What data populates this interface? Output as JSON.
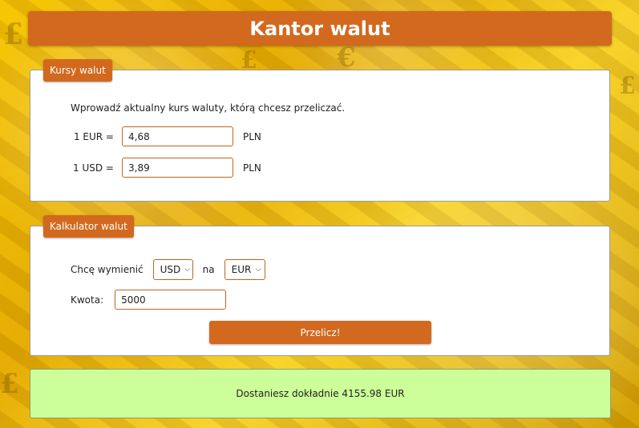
{
  "header": {
    "title": "Kantor walut"
  },
  "rates_panel": {
    "tab_label": "Kursy walut",
    "intro": "Wprowadź aktualny kurs waluty, którą chcesz przeliczać.",
    "eur": {
      "label": "1 EUR =",
      "value": "4,68",
      "unit": "PLN"
    },
    "usd": {
      "label": "1 USD =",
      "value": "3,89",
      "unit": "PLN"
    }
  },
  "calc_panel": {
    "tab_label": "Kalkulator walut",
    "exchange_label": "Chcę wymienić",
    "from_currency": "USD",
    "to_label": "na",
    "to_currency": "EUR",
    "amount_label": "Kwota:",
    "amount_value": "5000",
    "convert_label": "Przelicz!"
  },
  "result": {
    "text": "Dostaniesz dokładnie 4155.98 EUR"
  },
  "icons": {
    "dropdown": "chevron-down-icon"
  },
  "colors": {
    "accent": "#d2691e",
    "result_bg": "#ccff99"
  }
}
